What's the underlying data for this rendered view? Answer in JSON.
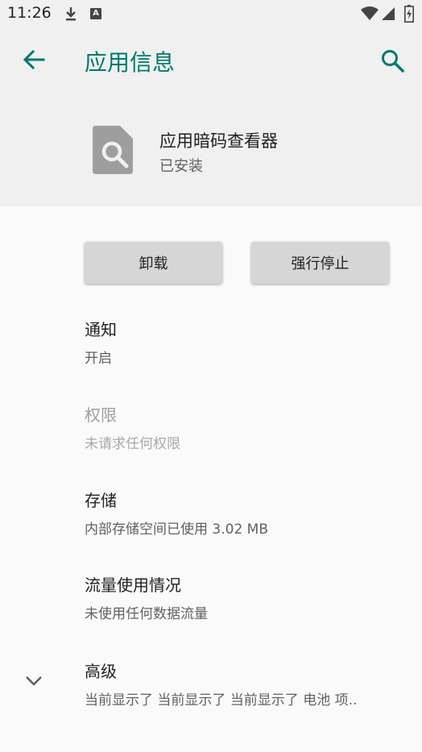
{
  "status_bar": {
    "time": "11:26",
    "icons": [
      "download-icon",
      "a-notification-icon",
      "wifi-icon",
      "cell-signal-icon",
      "battery-icon"
    ]
  },
  "toolbar": {
    "title": "应用信息",
    "back_icon": "arrow-back-icon",
    "search_icon": "search-icon"
  },
  "app": {
    "name": "应用暗码查看器",
    "status": "已安装",
    "icon": "file-search-icon"
  },
  "buttons": {
    "uninstall": "卸载",
    "force_stop": "强行停止"
  },
  "settings": [
    {
      "title": "通知",
      "subtitle": "开启",
      "enabled": true
    },
    {
      "title": "权限",
      "subtitle": "未请求任何权限",
      "enabled": false
    },
    {
      "title": "存储",
      "subtitle": "内部存储空间已使用 3.02 MB",
      "enabled": true
    },
    {
      "title": "流量使用情况",
      "subtitle": "未使用任何数据流量",
      "enabled": true
    },
    {
      "title": "高级",
      "subtitle": "当前显示了 当前显示了 当前显示了 电池 项..",
      "enabled": true
    }
  ],
  "colors": {
    "accent": "#00796b",
    "header_bg": "#f0f0f0",
    "body_bg": "#fafafa",
    "button_bg": "#d6d6d6"
  }
}
